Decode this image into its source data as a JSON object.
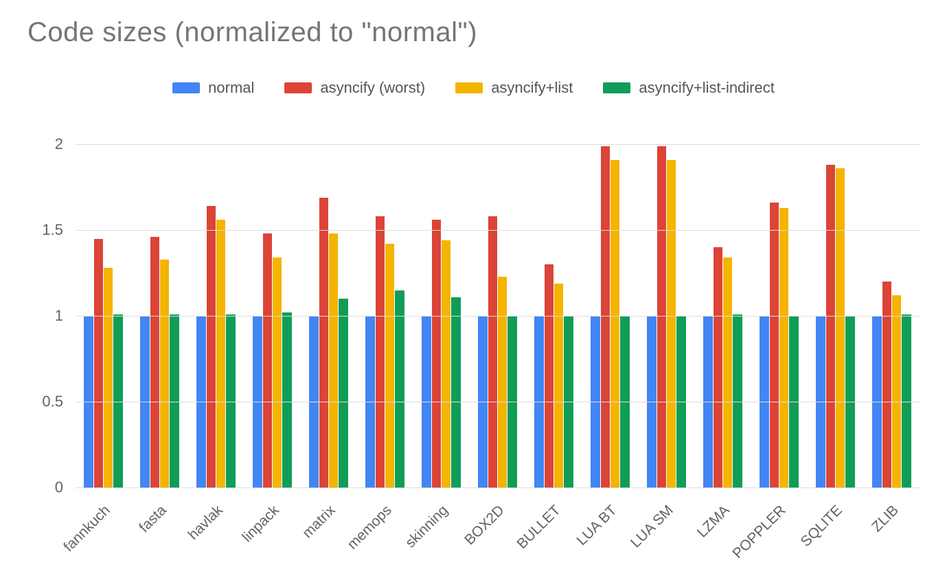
{
  "chart_data": {
    "type": "bar",
    "title": "Code sizes (normalized to \"normal\")",
    "xlabel": "",
    "ylabel": "",
    "ylim": [
      0,
      2.1
    ],
    "yticks": [
      0,
      0.5,
      1,
      1.5,
      2
    ],
    "categories": [
      "fannkuch",
      "fasta",
      "havlak",
      "linpack",
      "matrix",
      "memops",
      "skinning",
      "BOX2D",
      "BULLET",
      "LUA BT",
      "LUA SM",
      "LZMA",
      "POPPLER",
      "SQLITE",
      "ZLIB"
    ],
    "series": [
      {
        "name": "normal",
        "color": "#4285F4",
        "values": [
          1.0,
          1.0,
          1.0,
          1.0,
          1.0,
          1.0,
          1.0,
          1.0,
          1.0,
          1.0,
          1.0,
          1.0,
          1.0,
          1.0,
          1.0
        ]
      },
      {
        "name": "asyncify (worst)",
        "color": "#DB4437",
        "values": [
          1.45,
          1.46,
          1.64,
          1.48,
          1.69,
          1.58,
          1.56,
          1.58,
          1.3,
          1.99,
          1.99,
          1.4,
          1.66,
          1.88,
          1.2
        ]
      },
      {
        "name": "asyncify+list",
        "color": "#F4B400",
        "values": [
          1.28,
          1.33,
          1.56,
          1.34,
          1.48,
          1.42,
          1.44,
          1.23,
          1.19,
          1.91,
          1.91,
          1.34,
          1.63,
          1.86,
          1.12
        ]
      },
      {
        "name": "asyncify+list-indirect",
        "color": "#0F9D58",
        "values": [
          1.01,
          1.01,
          1.01,
          1.02,
          1.1,
          1.15,
          1.11,
          1.0,
          1.0,
          1.0,
          1.0,
          1.01,
          1.0,
          1.0,
          1.01
        ]
      }
    ]
  }
}
